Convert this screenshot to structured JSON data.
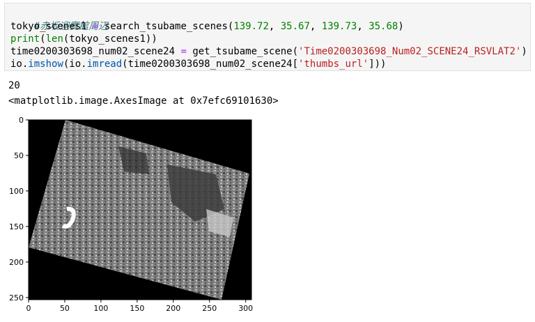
{
  "cell": {
    "comment": "#赤坂迎賓館周辺",
    "line1": {
      "var": "tokyo_scenes1",
      "eq": " = ",
      "call": "search_tsubame_scenes(",
      "a1": "139.72",
      "a2": "35.67",
      "a3": "139.73",
      "a4": "35.68",
      "sep": ", ",
      "close": ")"
    },
    "line2": {
      "print": "print",
      "open": "(",
      "len": "len",
      "arg": "(tokyo_scenes1))"
    },
    "line3": {
      "var": "time0200303698_num02_scene24",
      "eq": " = ",
      "call": "get_tsubame_scene(",
      "str": "'Time0200303698_Num02_SCENE24_RSVLAT2'",
      "close": ")"
    },
    "line4": {
      "mod1": "io.",
      "fn1": "imshow",
      "mid": "(io.",
      "fn2": "imread",
      "arg": "(time0200303698_num02_scene24[",
      "str": "'thumbs_url'",
      "close": "]))"
    }
  },
  "output": {
    "count": "20",
    "repr": "<matplotlib.image.AxesImage at 0x7efc69101630>"
  },
  "chart_data": {
    "type": "image",
    "x_ticks": [
      "0",
      "50",
      "100",
      "150",
      "200",
      "250",
      "300"
    ],
    "y_ticks": [
      "0",
      "50",
      "100",
      "150",
      "200",
      "250"
    ],
    "xlim": [
      0,
      308
    ],
    "ylim": [
      253,
      0
    ],
    "image_content": "rotated grayscale satellite scene on black background"
  }
}
